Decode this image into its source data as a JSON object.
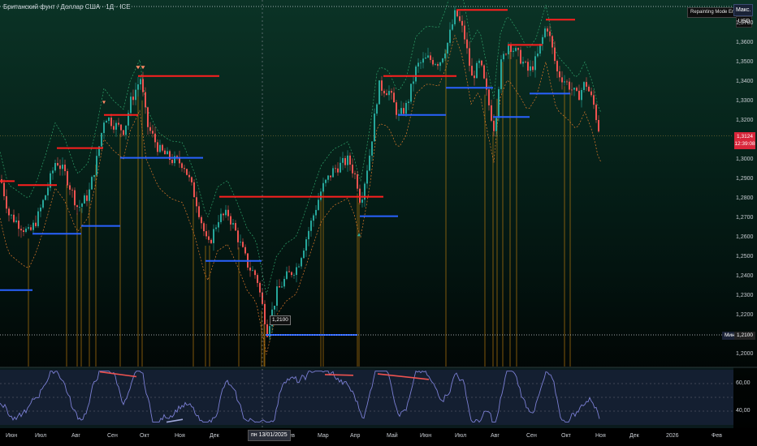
{
  "chart_title": "Британский фунт / Доллар США · 1Д · ICE",
  "repaint_label": "Repainting Mode Enabled",
  "max_tag": "Макс.",
  "currency_button": "USD",
  "current_price": {
    "value": "1,3124",
    "countdown": "12:39:08"
  },
  "min_tag": "Мин.",
  "min_price": "1,2100",
  "low_label": "1,2100",
  "date_cursor": "пн 13/01/2025",
  "colors": {
    "bull": "#26a69a",
    "bear": "#ef5350",
    "resistance": "#ff1f1f",
    "support": "#2962ff",
    "rsi": "#7b7fd4",
    "vline": "#c6820e"
  },
  "price_axis": [
    {
      "label": "1,3700",
      "value": 1.37
    },
    {
      "label": "1,3600",
      "value": 1.36
    },
    {
      "label": "1,3500",
      "value": 1.35
    },
    {
      "label": "1,3400",
      "value": 1.34
    },
    {
      "label": "1,3300",
      "value": 1.33
    },
    {
      "label": "1,3200",
      "value": 1.32
    },
    {
      "label": "1,3000",
      "value": 1.3
    },
    {
      "label": "1,2900",
      "value": 1.29
    },
    {
      "label": "1,2800",
      "value": 1.28
    },
    {
      "label": "1,2700",
      "value": 1.27
    },
    {
      "label": "1,2600",
      "value": 1.26
    },
    {
      "label": "1,2500",
      "value": 1.25
    },
    {
      "label": "1,2400",
      "value": 1.24
    },
    {
      "label": "1,2300",
      "value": 1.23
    },
    {
      "label": "1,2200",
      "value": 1.22
    },
    {
      "label": "1,2000",
      "value": 1.2
    }
  ],
  "rsi_axis": [
    {
      "label": "60,00",
      "value": 60
    },
    {
      "label": "40,00",
      "value": 40
    }
  ],
  "time_axis": [
    {
      "label": "Июн",
      "pos": 0.007
    },
    {
      "label": "Июл",
      "pos": 0.046
    },
    {
      "label": "Авг",
      "pos": 0.094
    },
    {
      "label": "Сен",
      "pos": 0.142
    },
    {
      "label": "Окт",
      "pos": 0.185
    },
    {
      "label": "Ноя",
      "pos": 0.231
    },
    {
      "label": "Дек",
      "pos": 0.277
    },
    {
      "label": "Фев",
      "pos": 0.376
    },
    {
      "label": "Мар",
      "pos": 0.419
    },
    {
      "label": "Апр",
      "pos": 0.462
    },
    {
      "label": "Май",
      "pos": 0.511
    },
    {
      "label": "Июн",
      "pos": 0.555
    },
    {
      "label": "Июл",
      "pos": 0.601
    },
    {
      "label": "Авг",
      "pos": 0.648
    },
    {
      "label": "Сен",
      "pos": 0.695
    },
    {
      "label": "Окт",
      "pos": 0.741
    },
    {
      "label": "Ноя",
      "pos": 0.787
    },
    {
      "label": "Дек",
      "pos": 0.832
    },
    {
      "label": "2026",
      "pos": 0.88
    },
    {
      "label": "Фев",
      "pos": 0.94
    }
  ],
  "chart_data": {
    "type": "candlestick",
    "instrument": "GBP/USD",
    "timeframe": "1D",
    "y_range": [
      1.195,
      1.377
    ],
    "rsi_range": [
      30,
      70
    ],
    "price_path": [
      [
        0,
        1.29
      ],
      [
        10,
        1.272
      ],
      [
        20,
        1.268
      ],
      [
        35,
        1.262
      ],
      [
        45,
        1.27
      ],
      [
        55,
        1.282
      ],
      [
        68,
        1.3
      ],
      [
        80,
        1.292
      ],
      [
        95,
        1.275
      ],
      [
        108,
        1.282
      ],
      [
        118,
        1.3
      ],
      [
        128,
        1.323
      ],
      [
        140,
        1.318
      ],
      [
        152,
        1.315
      ],
      [
        160,
        1.33
      ],
      [
        172,
        1.342
      ],
      [
        180,
        1.318
      ],
      [
        195,
        1.305
      ],
      [
        210,
        1.3
      ],
      [
        225,
        1.298
      ],
      [
        240,
        1.28
      ],
      [
        255,
        1.255
      ],
      [
        268,
        1.27
      ],
      [
        280,
        1.272
      ],
      [
        290,
        1.262
      ],
      [
        305,
        1.245
      ],
      [
        315,
        1.24
      ],
      [
        328,
        1.212
      ],
      [
        340,
        1.232
      ],
      [
        352,
        1.24
      ],
      [
        365,
        1.245
      ],
      [
        380,
        1.265
      ],
      [
        395,
        1.285
      ],
      [
        410,
        1.295
      ],
      [
        428,
        1.3
      ],
      [
        438,
        1.29
      ],
      [
        443,
        1.278
      ],
      [
        455,
        1.305
      ],
      [
        465,
        1.338
      ],
      [
        478,
        1.335
      ],
      [
        490,
        1.322
      ],
      [
        500,
        1.328
      ],
      [
        512,
        1.348
      ],
      [
        525,
        1.352
      ],
      [
        540,
        1.35
      ],
      [
        550,
        1.36
      ],
      [
        560,
        1.376
      ],
      [
        570,
        1.365
      ],
      [
        580,
        1.342
      ],
      [
        590,
        1.35
      ],
      [
        600,
        1.33
      ],
      [
        608,
        1.315
      ],
      [
        615,
        1.348
      ],
      [
        625,
        1.36
      ],
      [
        640,
        1.352
      ],
      [
        650,
        1.345
      ],
      [
        660,
        1.352
      ],
      [
        672,
        1.37
      ],
      [
        685,
        1.345
      ],
      [
        700,
        1.338
      ],
      [
        710,
        1.332
      ],
      [
        720,
        1.34
      ],
      [
        730,
        1.328
      ],
      [
        738,
        1.312
      ]
    ],
    "resistance_levels": [
      {
        "price": 1.289,
        "x0": 0,
        "x1": 18
      },
      {
        "price": 1.287,
        "x0": 22,
        "x1": 70
      },
      {
        "price": 1.306,
        "x0": 70,
        "x1": 127
      },
      {
        "price": 1.323,
        "x0": 128,
        "x1": 170
      },
      {
        "price": 1.343,
        "x0": 170,
        "x1": 270
      },
      {
        "price": 1.281,
        "x0": 270,
        "x1": 472
      },
      {
        "price": 1.343,
        "x0": 472,
        "x1": 562
      },
      {
        "price": 1.377,
        "x0": 562,
        "x1": 625
      },
      {
        "price": 1.359,
        "x0": 625,
        "x1": 668
      },
      {
        "price": 1.372,
        "x0": 672,
        "x1": 708
      }
    ],
    "support_levels": [
      {
        "price": 1.233,
        "x0": 0,
        "x1": 40
      },
      {
        "price": 1.262,
        "x0": 40,
        "x1": 100
      },
      {
        "price": 1.266,
        "x0": 100,
        "x1": 148
      },
      {
        "price": 1.301,
        "x0": 148,
        "x1": 250
      },
      {
        "price": 1.248,
        "x0": 253,
        "x1": 322
      },
      {
        "price": 1.21,
        "x0": 327,
        "x1": 440
      },
      {
        "price": 1.271,
        "x0": 443,
        "x1": 490
      },
      {
        "price": 1.323,
        "x0": 490,
        "x1": 549
      },
      {
        "price": 1.337,
        "x0": 549,
        "x1": 607
      },
      {
        "price": 1.322,
        "x0": 607,
        "x1": 652
      },
      {
        "price": 1.334,
        "x0": 652,
        "x1": 702
      }
    ],
    "swing_marker_x": [
      35,
      82,
      95,
      100,
      110,
      118,
      148,
      170,
      175,
      238,
      253,
      258,
      294,
      322,
      325,
      326,
      395,
      398,
      440,
      442,
      549,
      597,
      607,
      612,
      619,
      628,
      636,
      695,
      702
    ],
    "rsi_divergences": [
      {
        "type": "bearish",
        "x0": 123,
        "x1": 168,
        "v0": 68.5,
        "v1": 65
      },
      {
        "type": "bearish",
        "x0": 400,
        "x1": 435,
        "v0": 66.5,
        "v1": 66
      },
      {
        "type": "bearish",
        "x0": 465,
        "x1": 528,
        "v0": 67,
        "v1": 63
      },
      {
        "type": "bullish",
        "x0": 205,
        "x1": 225,
        "v0": 32,
        "v1": 34
      }
    ]
  }
}
